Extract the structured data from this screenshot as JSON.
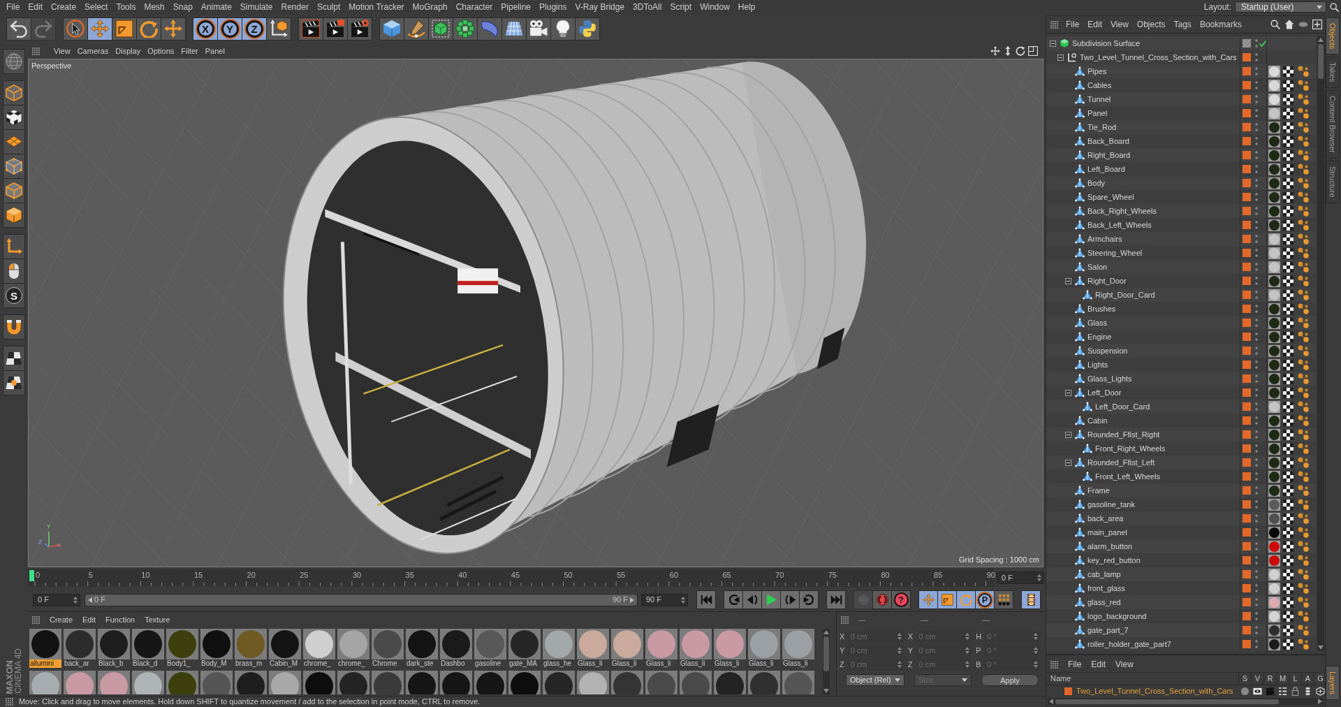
{
  "menu_bar": {
    "items": [
      "File",
      "Edit",
      "Create",
      "Select",
      "Tools",
      "Mesh",
      "Snap",
      "Animate",
      "Simulate",
      "Render",
      "Sculpt",
      "Motion Tracker",
      "MoGraph",
      "Character",
      "Pipeline",
      "Plugins",
      "V-Ray Bridge",
      "3DToAll",
      "Script",
      "Window",
      "Help"
    ],
    "layout_label": "Layout:",
    "layout_value": "Startup (User)"
  },
  "toolbar": {
    "groups": [
      [
        {
          "kind": "undo",
          "on": false
        },
        {
          "kind": "redo",
          "on": false,
          "disabled": true
        }
      ],
      [
        {
          "kind": "select",
          "on": false
        },
        {
          "kind": "move",
          "on": true
        },
        {
          "kind": "scale",
          "on": false
        },
        {
          "kind": "rotate",
          "on": false
        },
        {
          "kind": "add",
          "on": false
        }
      ],
      [
        {
          "kind": "axis",
          "label": "X",
          "on": true
        },
        {
          "kind": "axis",
          "label": "Y",
          "on": true
        },
        {
          "kind": "axis",
          "label": "Z",
          "on": true
        },
        {
          "kind": "coordinates",
          "on": false
        }
      ],
      [
        {
          "kind": "render_view",
          "on": false
        },
        {
          "kind": "render_picture",
          "on": false
        },
        {
          "kind": "render_settings",
          "on": false
        }
      ],
      [
        {
          "kind": "cube",
          "on": false
        },
        {
          "kind": "pen",
          "on": false
        },
        {
          "kind": "subdivision",
          "on": false
        },
        {
          "kind": "cloner",
          "on": false
        },
        {
          "kind": "deformer",
          "on": false
        },
        {
          "kind": "floor",
          "on": false
        },
        {
          "kind": "camera",
          "on": false
        },
        {
          "kind": "light",
          "on": false
        },
        {
          "kind": "script",
          "on": false
        }
      ]
    ]
  },
  "left_toolbar": {
    "groups": [
      [
        {
          "kind": "sphere",
          "on": false
        }
      ],
      [
        {
          "kind": "model",
          "on": false
        },
        {
          "kind": "texture",
          "on": false
        },
        {
          "kind": "workplane",
          "on": false
        },
        {
          "kind": "points",
          "on": false
        },
        {
          "kind": "edges",
          "on": false
        },
        {
          "kind": "polygons",
          "on": false
        }
      ],
      [
        {
          "kind": "axis_mode",
          "on": false
        },
        {
          "kind": "tweak",
          "on": false
        },
        {
          "kind": "snap",
          "label": "S",
          "on": false
        }
      ],
      [
        {
          "kind": "magnet",
          "on": false
        }
      ],
      [
        {
          "kind": "grid_lock",
          "on": false
        },
        {
          "kind": "grid_snap",
          "on": false
        }
      ]
    ]
  },
  "logo": {
    "brand": "MAXON",
    "product": "CINEMA 4D"
  },
  "viewport": {
    "menu": [
      "View",
      "Cameras",
      "Display",
      "Options",
      "Filter",
      "Panel"
    ],
    "camera": "Perspective",
    "grid_spacing": "Grid Spacing : 1000 cm",
    "axis_labels": [
      "Y",
      "Z",
      "X"
    ]
  },
  "timeline": {
    "ticks": [
      "0",
      "5",
      "10",
      "15",
      "20",
      "25",
      "30",
      "35",
      "40",
      "45",
      "50",
      "55",
      "60",
      "65",
      "70",
      "75",
      "80",
      "85",
      "90"
    ],
    "level": 0,
    "current": "0 F"
  },
  "playback": {
    "start": "0 F",
    "range": {
      "start": "0 F",
      "end": "90 F",
      "level": 1
    },
    "end": "90 F",
    "groups": [
      [
        {
          "kind": "first"
        }
      ],
      [
        {
          "kind": "prev_key"
        },
        {
          "kind": "prev_frame"
        },
        {
          "kind": "play"
        },
        {
          "kind": "next_frame"
        },
        {
          "kind": "next_key"
        }
      ],
      [
        {
          "kind": "last"
        }
      ],
      [
        {
          "kind": "record",
          "on": false,
          "disabled": true
        },
        {
          "kind": "autokey",
          "on": false
        },
        {
          "kind": "help",
          "label": "?",
          "on": false
        }
      ],
      [
        {
          "kind": "key_move",
          "on": true
        },
        {
          "kind": "key_scale",
          "on": true
        },
        {
          "kind": "key_rotate",
          "on": true
        },
        {
          "kind": "key_param",
          "label": "P",
          "on": true
        },
        {
          "kind": "key_pla",
          "on": false
        }
      ],
      [
        {
          "kind": "timeline",
          "on": true
        }
      ]
    ]
  },
  "materials": {
    "menu": [
      "Create",
      "Edit",
      "Function",
      "Texture"
    ],
    "items": [
      {
        "name": "allumini",
        "color": "#121212",
        "selected": true
      },
      {
        "name": "back_ar",
        "color": "#2c2c2c",
        "selected": false
      },
      {
        "name": "Black_b",
        "color": "#1e1e1e",
        "selected": false
      },
      {
        "name": "Black_d",
        "color": "#161616",
        "selected": false
      },
      {
        "name": "Body1_",
        "color": "#3d3f0c",
        "selected": false
      },
      {
        "name": "Body_M",
        "color": "#101010",
        "selected": false
      },
      {
        "name": "brass_m",
        "color": "#6e5a22",
        "selected": false
      },
      {
        "name": "Cabin_M",
        "color": "#141414",
        "selected": false
      },
      {
        "name": "chrome_",
        "color": "#cfcfcf",
        "selected": false
      },
      {
        "name": "chrome_",
        "color": "#a5a5a5",
        "selected": false
      },
      {
        "name": "Chrome",
        "color": "#4a4a4a",
        "selected": false
      },
      {
        "name": "dark_ste",
        "color": "#141414",
        "selected": false
      },
      {
        "name": "Dashbo",
        "color": "#1a1a1a",
        "selected": false
      },
      {
        "name": "gasoline",
        "color": "#585858",
        "selected": false
      },
      {
        "name": "gate_MA",
        "color": "#262626",
        "selected": false
      },
      {
        "name": "glass_he",
        "color": "#a3a8ab",
        "selected": false
      },
      {
        "name": "Glass_li",
        "color": "#c9aa9d",
        "selected": false
      },
      {
        "name": "Glass_li",
        "color": "#c9aa9d",
        "selected": false
      },
      {
        "name": "Glass_li",
        "color": "#c99aa3",
        "selected": false
      },
      {
        "name": "Glass_li",
        "color": "#c99aa3",
        "selected": false
      },
      {
        "name": "Glass_li",
        "color": "#c99aa3",
        "selected": false
      },
      {
        "name": "Glass_li",
        "color": "#9aa0a3",
        "selected": false
      },
      {
        "name": "Glass_li",
        "color": "#9aa0a3",
        "selected": false
      }
    ],
    "second_row": [
      {
        "color": "#a6adb1"
      },
      {
        "color": "#c99aa3"
      },
      {
        "color": "#c99aa3"
      },
      {
        "color": "#aeb3b6"
      },
      {
        "color": "#3d3f0c"
      },
      {
        "color": "#555555"
      },
      {
        "color": "#1e1e1e"
      },
      {
        "color": "#a8a8a8"
      },
      {
        "color": "#0e0e0e"
      },
      {
        "color": "#242424"
      },
      {
        "color": "#3a3a3a"
      },
      {
        "color": "#161616"
      },
      {
        "color": "#161616"
      },
      {
        "color": "#161616"
      },
      {
        "color": "#0e0e0e"
      },
      {
        "color": "#262626"
      },
      {
        "color": "#b2b2b2"
      },
      {
        "color": "#343434"
      },
      {
        "color": "#4a4a4a"
      },
      {
        "color": "#4a4a4a"
      },
      {
        "color": "#242424"
      },
      {
        "color": "#303030"
      },
      {
        "color": "#555555"
      }
    ]
  },
  "coordinates": {
    "headers": [
      "—",
      "—",
      "—"
    ],
    "disabled": true,
    "position": [
      {
        "axis": "X",
        "value": "0 cm"
      },
      {
        "axis": "Y",
        "value": "0 cm"
      },
      {
        "axis": "Z",
        "value": "0 cm"
      }
    ],
    "size": [
      {
        "axis": "X",
        "value": "0 cm"
      },
      {
        "axis": "Y",
        "value": "0 cm"
      },
      {
        "axis": "Z",
        "value": "0 cm"
      }
    ],
    "rotation": [
      {
        "axis": "H",
        "value": "0 °"
      },
      {
        "axis": "P",
        "value": "0 °"
      },
      {
        "axis": "B",
        "value": "0 °"
      }
    ],
    "mode": "Object (Rel)",
    "size_mode": {
      "label": "Size",
      "disabled": true
    },
    "apply": "Apply"
  },
  "object_manager": {
    "menu": [
      "File",
      "Edit",
      "View",
      "Objects",
      "Tags",
      "Bookmarks"
    ],
    "tree": [
      {
        "name": "Subdivision Surface",
        "kind": "generator",
        "expanded": true,
        "children": [
          {
            "name": "Two_Level_Tunnel_Cross_Section_with_Cars",
            "kind": "null",
            "expanded": true,
            "children": [
              {
                "name": "Pipes",
                "kind": "polygon",
                "color": "#d9d9d9"
              },
              {
                "name": "Cables",
                "kind": "polygon",
                "color": "#d9d9d9"
              },
              {
                "name": "Tunnel",
                "kind": "polygon",
                "color": "#d9d9d9"
              },
              {
                "name": "Panel",
                "kind": "polygon",
                "color": "#c4c4c4"
              },
              {
                "name": "Tie_Rod",
                "kind": "polygon",
                "color": "#1f2a14"
              },
              {
                "name": "Back_Board",
                "kind": "polygon",
                "color": "#1f2a14"
              },
              {
                "name": "Right_Board",
                "kind": "polygon",
                "color": "#1f2a14"
              },
              {
                "name": "Left_Board",
                "kind": "polygon",
                "color": "#1f2a14"
              },
              {
                "name": "Body",
                "kind": "polygon",
                "color": "#1f2a14"
              },
              {
                "name": "Spare_Wheel",
                "kind": "polygon",
                "color": "#1f2a14"
              },
              {
                "name": "Back_Right_Wheels",
                "kind": "polygon",
                "color": "#1f2a14"
              },
              {
                "name": "Back_Left_Wheels",
                "kind": "polygon",
                "color": "#1f2a14"
              },
              {
                "name": "Armchairs",
                "kind": "polygon",
                "color": "#c4c4c4"
              },
              {
                "name": "Steering_Wheel",
                "kind": "polygon",
                "color": "#c4c4c4"
              },
              {
                "name": "Salon",
                "kind": "polygon",
                "color": "#c4c4c4"
              },
              {
                "name": "Right_Door",
                "kind": "polygon",
                "color": "#1f2a14",
                "expanded": true,
                "children": [
                  {
                    "name": "Right_Door_Card",
                    "kind": "polygon",
                    "color": "#c4c4c4"
                  }
                ]
              },
              {
                "name": "Brushes",
                "kind": "polygon",
                "color": "#1f2a14"
              },
              {
                "name": "Glass",
                "kind": "polygon",
                "color": "#1f2a14"
              },
              {
                "name": "Engine",
                "kind": "polygon",
                "color": "#1f2a14"
              },
              {
                "name": "Suspension",
                "kind": "polygon",
                "color": "#1f2a14"
              },
              {
                "name": "Lights",
                "kind": "polygon",
                "color": "#1f2a14"
              },
              {
                "name": "Glass_Lights",
                "kind": "polygon",
                "color": "#1f2a14"
              },
              {
                "name": "Left_Door",
                "kind": "polygon",
                "color": "#1f2a14",
                "expanded": true,
                "children": [
                  {
                    "name": "Left_Door_Card",
                    "kind": "polygon",
                    "color": "#c4c4c4"
                  }
                ]
              },
              {
                "name": "Cabin",
                "kind": "polygon",
                "color": "#1f2a14"
              },
              {
                "name": "Rounded_Ffist_Right",
                "kind": "polygon",
                "color": "#1f2a14",
                "expanded": true,
                "children": [
                  {
                    "name": "Front_Right_Wheels",
                    "kind": "polygon",
                    "color": "#1f2a14"
                  }
                ]
              },
              {
                "name": "Rounded_Ffist_Left",
                "kind": "polygon",
                "color": "#1f2a14",
                "expanded": true,
                "children": [
                  {
                    "name": "Front_Left_Wheels",
                    "kind": "polygon",
                    "color": "#1f2a14"
                  }
                ]
              },
              {
                "name": "Frame",
                "kind": "polygon",
                "color": "#1f2a14"
              },
              {
                "name": "gasoline_tank",
                "kind": "polygon",
                "color": "#5a5a5a"
              },
              {
                "name": "back_area",
                "kind": "polygon",
                "color": "#505050"
              },
              {
                "name": "main_panel",
                "kind": "polygon",
                "color": "#080808"
              },
              {
                "name": "alarm_button",
                "kind": "polygon",
                "color": "#cc0a0a"
              },
              {
                "name": "key_red_button",
                "kind": "polygon",
                "color": "#cc0a0a"
              },
              {
                "name": "cab_lamp",
                "kind": "polygon",
                "color": "#d0d0d0"
              },
              {
                "name": "front_glass",
                "kind": "polygon",
                "color": "#d0d0d0"
              },
              {
                "name": "glass_red",
                "kind": "polygon",
                "color": "#e0a8b0"
              },
              {
                "name": "logo_background",
                "kind": "polygon",
                "color": "#d4d4d4"
              },
              {
                "name": "gate_part_7",
                "kind": "polygon",
                "color": "#2e2e2e"
              },
              {
                "name": "roller_holder_gate_part7",
                "kind": "polygon",
                "color": "#1c1c1c"
              }
            ]
          }
        ]
      }
    ]
  },
  "layer_manager": {
    "menu": [
      "File",
      "Edit",
      "View"
    ],
    "columns": [
      "Name",
      "S",
      "V",
      "R",
      "M",
      "L",
      "A",
      "G"
    ],
    "layers": [
      {
        "name": "Two_Level_Tunnel_Cross_Section_with_Cars",
        "color": "#e0662a"
      }
    ]
  },
  "side_tabs": [
    {
      "label": "Objects",
      "selected": true
    },
    {
      "label": "Takes",
      "selected": false
    },
    {
      "label": "Content Browser",
      "selected": false
    },
    {
      "label": "Structure",
      "selected": false
    }
  ],
  "bottom_tabs": [
    {
      "label": "Layers",
      "selected": true
    }
  ],
  "status_bar": "Move: Click and drag to move elements. Hold down SHIFT to quantize movement / add to the selection in point mode, CTRL to remove."
}
